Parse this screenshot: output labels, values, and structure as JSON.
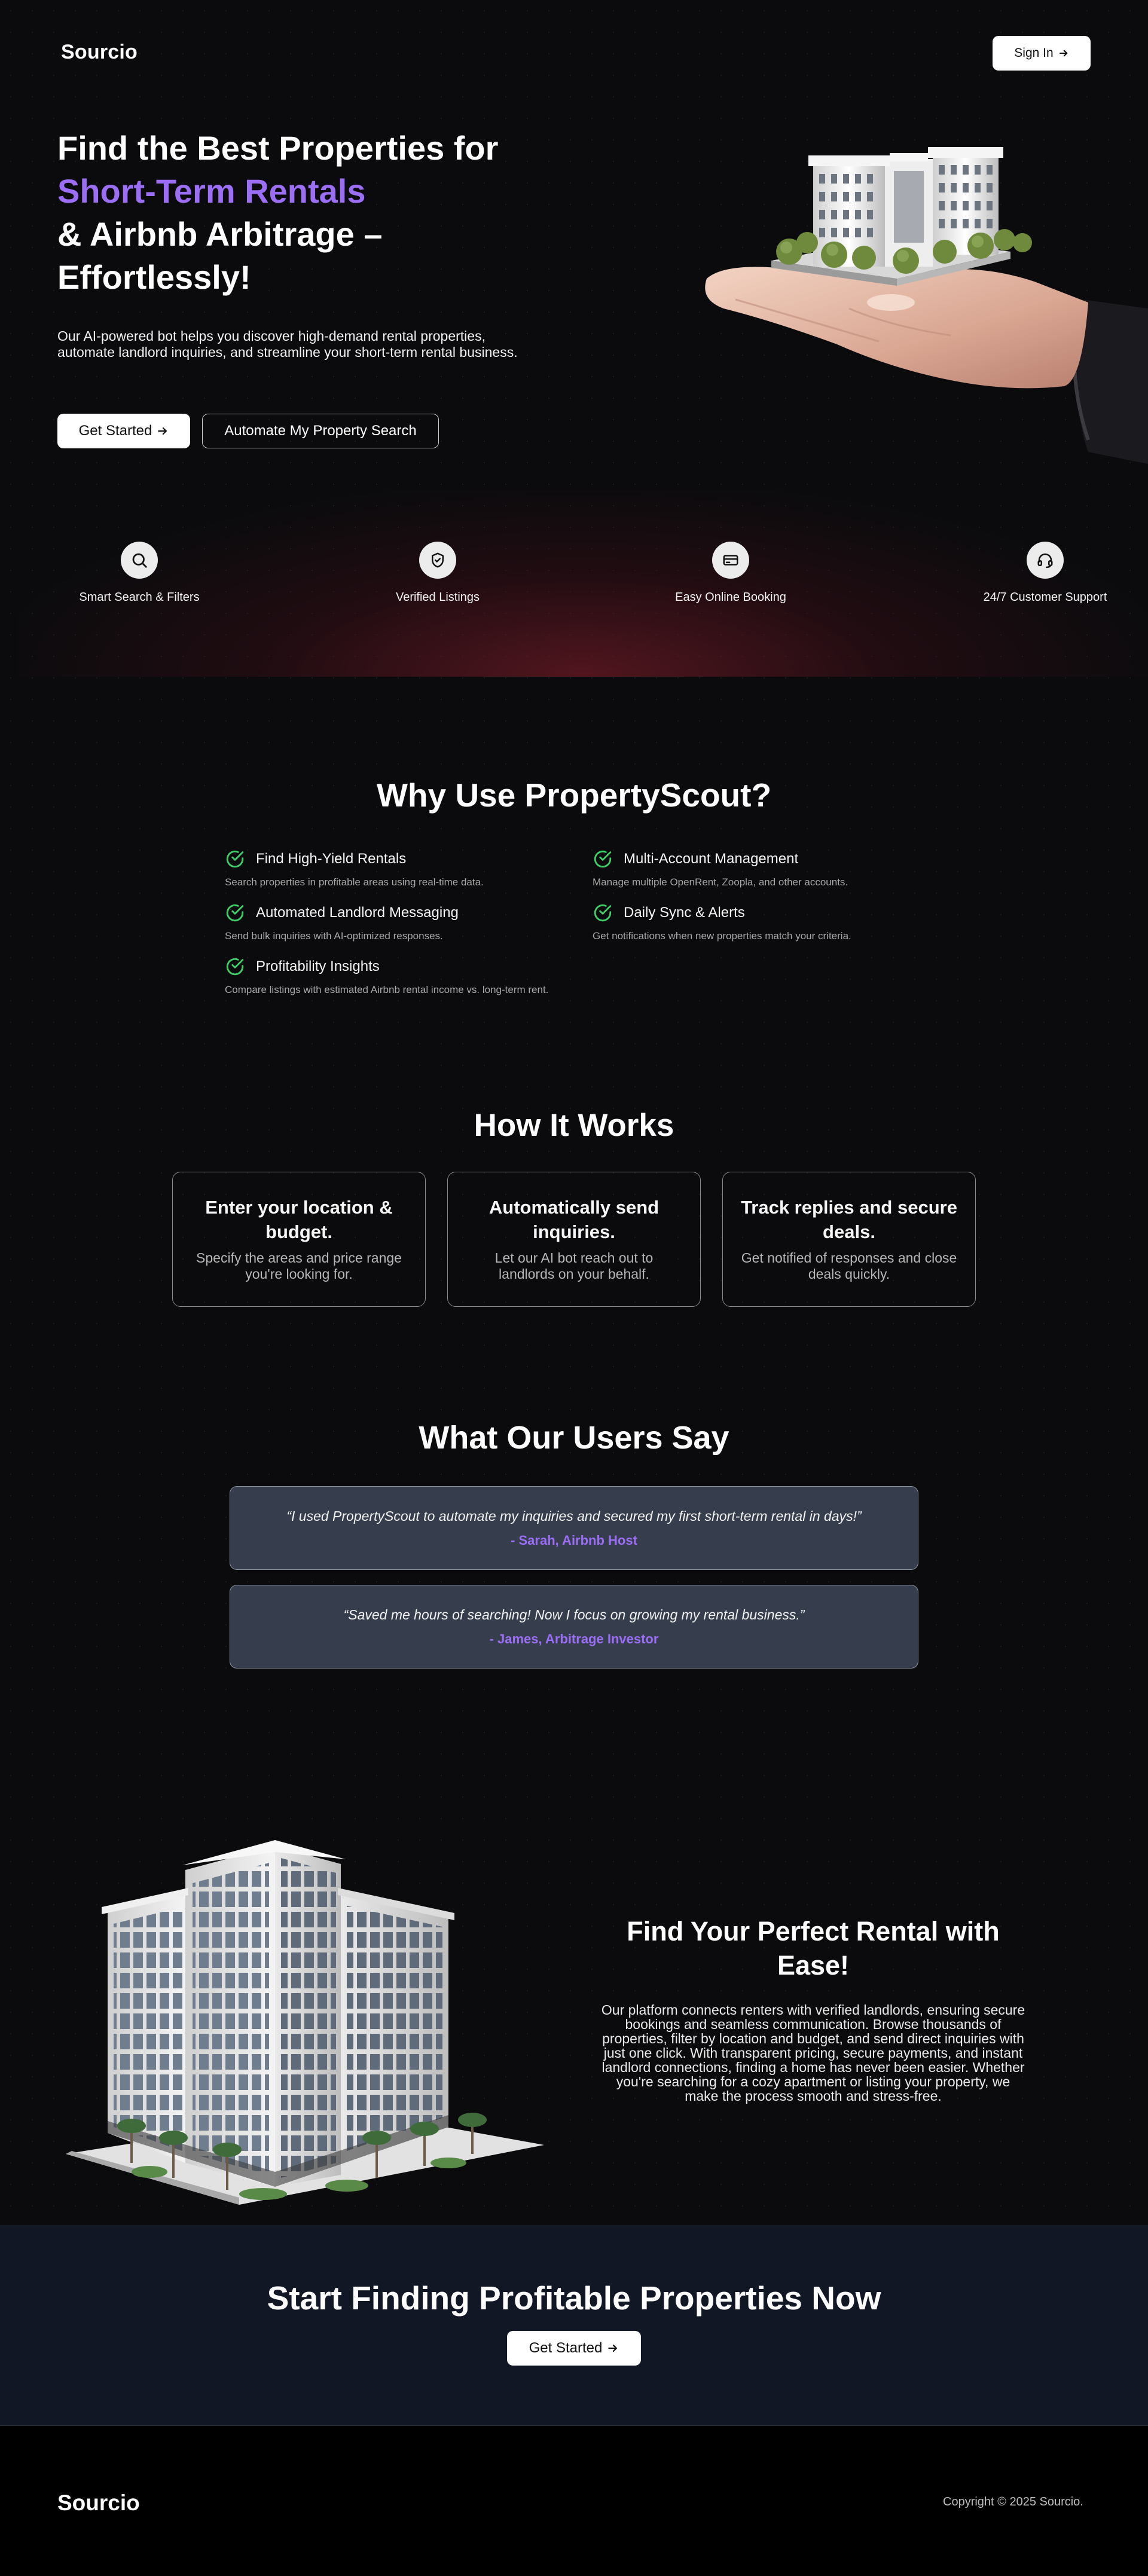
{
  "brand": {
    "name": "Sourcio",
    "accent_color": "#9b6ef5"
  },
  "header": {
    "signin_label": "Sign In",
    "signin_icon": "arrow-right-icon"
  },
  "hero": {
    "title_line1": "Find the Best Properties for",
    "title_accent": "Short-Term Rentals",
    "title_line3": "& Airbnb Arbitrage –",
    "title_line4": "Effortlessly!",
    "subtitle": "Our AI-powered bot helps you discover high-demand rental properties, automate landlord inquiries, and streamline your short-term rental business.",
    "cta_primary": "Get Started",
    "cta_secondary": "Automate My Property Search",
    "image": "hand-holding-building-illustration"
  },
  "features": [
    {
      "icon": "search-icon",
      "label": "Smart Search & Filters"
    },
    {
      "icon": "shield-check-icon",
      "label": "Verified Listings"
    },
    {
      "icon": "credit-card-icon",
      "label": "Easy Online Booking"
    },
    {
      "icon": "headset-icon",
      "label": "24/7 Customer Support"
    }
  ],
  "why": {
    "title": "Why Use PropertyScout?",
    "check_color": "#3fcf6a",
    "items": [
      {
        "title": "Find High-Yield Rentals",
        "desc": "Search properties in profitable areas using real-time data."
      },
      {
        "title": "Multi-Account Management",
        "desc": "Manage multiple OpenRent, Zoopla, and other accounts."
      },
      {
        "title": "Automated Landlord Messaging",
        "desc": "Send bulk inquiries with AI-optimized responses."
      },
      {
        "title": "Daily Sync & Alerts",
        "desc": "Get notifications when new properties match your criteria."
      },
      {
        "title": "Profitability Insights",
        "desc": "Compare listings with estimated Airbnb rental income vs. long-term rent."
      }
    ]
  },
  "how": {
    "title": "How It Works",
    "steps": [
      {
        "title": "Enter your location & budget.",
        "desc": "Specify the areas and price range you're looking for."
      },
      {
        "title": "Automatically send inquiries.",
        "desc": "Let our AI bot reach out to landlords on your behalf."
      },
      {
        "title": "Track replies and secure deals.",
        "desc": "Get notified of responses and close deals quickly."
      }
    ]
  },
  "testimonials": {
    "title": "What Our Users Say",
    "items": [
      {
        "quote": "“I used PropertyScout to automate my inquiries and secured my first short-term rental in days!”",
        "author": "- Sarah, Airbnb Host"
      },
      {
        "quote": "“Saved me hours of searching! Now I focus on growing my rental business.”",
        "author": "- James, Arbitrage Investor"
      }
    ]
  },
  "find": {
    "title": "Find Your Perfect Rental with Ease!",
    "body": "Our platform connects renters with verified landlords, ensuring secure bookings and seamless communication. Browse thousands of properties, filter by location and budget, and send direct inquiries with just one click. With transparent pricing, secure payments, and instant landlord connections, finding a home has never been easier. Whether you're searching for a cozy apartment or listing your property, we make the process smooth and stress-free.",
    "image": "office-building-illustration"
  },
  "cta": {
    "title": "Start Finding Profitable Properties Now",
    "button": "Get Started"
  },
  "footer": {
    "logo": "Sourcio",
    "copyright": "Copyright © 2025 Sourcio."
  }
}
